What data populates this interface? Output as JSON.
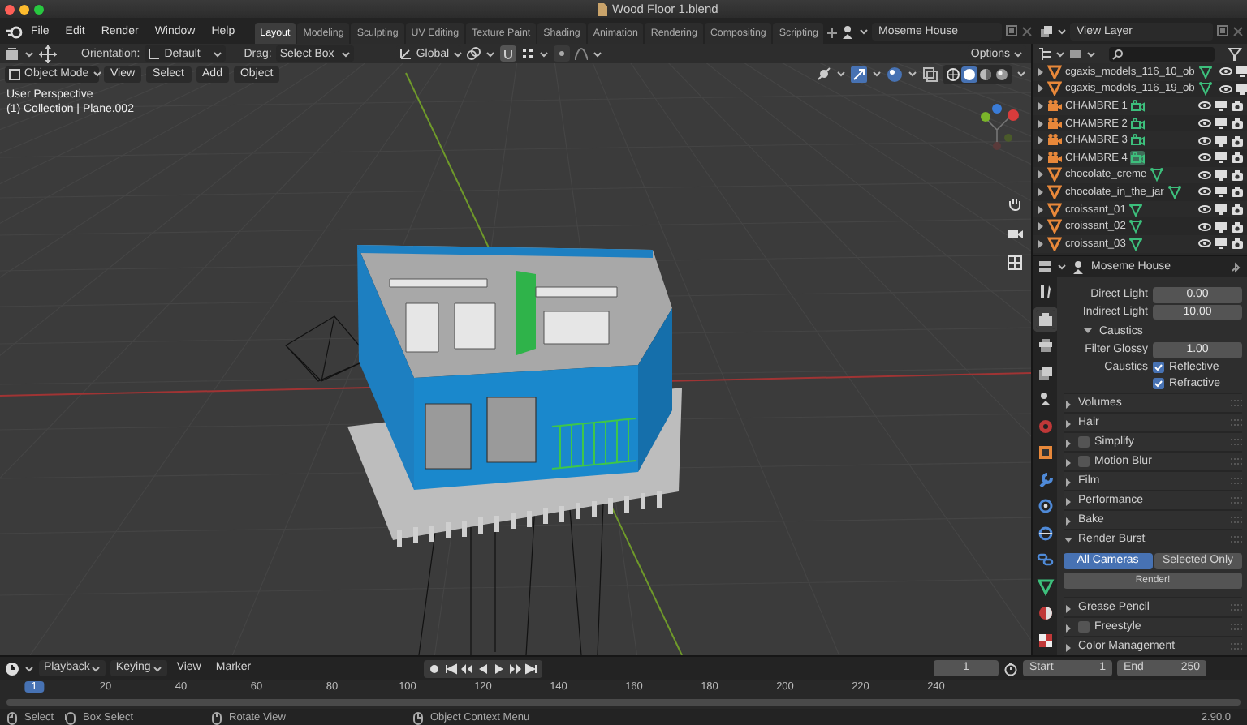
{
  "window": {
    "title": "Wood Floor 1.blend"
  },
  "menu": [
    "File",
    "Edit",
    "Render",
    "Window",
    "Help"
  ],
  "workspaces": [
    {
      "label": "Layout",
      "selected": true
    },
    {
      "label": "Modeling",
      "selected": false
    },
    {
      "label": "Sculpting",
      "selected": false
    },
    {
      "label": "UV Editing",
      "selected": false
    },
    {
      "label": "Texture Paint",
      "selected": false
    },
    {
      "label": "Shading",
      "selected": false
    },
    {
      "label": "Animation",
      "selected": false
    },
    {
      "label": "Rendering",
      "selected": false
    },
    {
      "label": "Compositing",
      "selected": false
    },
    {
      "label": "Scripting",
      "selected": false
    }
  ],
  "scene": {
    "name": "Moseme House"
  },
  "view_layer": {
    "name": "View Layer"
  },
  "tool_settings": {
    "orientation_label": "Orientation:",
    "orientation": "Default",
    "drag_label": "Drag:",
    "drag": "Select Box",
    "transform_orientation": "Global",
    "options": "Options"
  },
  "viewport_header": {
    "mode": "Object Mode",
    "menus": [
      "View",
      "Select",
      "Add",
      "Object"
    ],
    "shading": [
      {
        "kind": "wireframe",
        "selected": false
      },
      {
        "kind": "solid",
        "selected": true
      },
      {
        "kind": "material",
        "selected": false
      },
      {
        "kind": "rendered",
        "selected": false
      }
    ]
  },
  "viewport": {
    "perspective": "User Perspective",
    "context": "(1) Collection | Plane.002"
  },
  "outliner": {
    "items": [
      {
        "name": "cgaxis_models_116_10_ob",
        "kind": "mesh",
        "active": false
      },
      {
        "name": "cgaxis_models_116_19_ob",
        "kind": "mesh",
        "active": false
      },
      {
        "name": "CHAMBRE 1",
        "kind": "camera",
        "active": false
      },
      {
        "name": "CHAMBRE 2",
        "kind": "camera",
        "active": false
      },
      {
        "name": "CHAMBRE 3",
        "kind": "camera",
        "active": false
      },
      {
        "name": "CHAMBRE 4",
        "kind": "camera",
        "active": true
      },
      {
        "name": "chocolate_creme",
        "kind": "mesh",
        "active": false
      },
      {
        "name": "chocolate_in_the_jar",
        "kind": "mesh",
        "active": false
      },
      {
        "name": "croissant_01",
        "kind": "mesh",
        "active": false
      },
      {
        "name": "croissant_02",
        "kind": "mesh",
        "active": false
      },
      {
        "name": "croissant_03",
        "kind": "mesh",
        "active": false
      }
    ]
  },
  "properties": {
    "object": "Moseme House",
    "tabs": [
      {
        "kind": "tool",
        "selected": false
      },
      {
        "kind": "render",
        "selected": true
      },
      {
        "kind": "output",
        "selected": false
      },
      {
        "kind": "view_layer",
        "selected": false
      },
      {
        "kind": "scene",
        "selected": false
      },
      {
        "kind": "world",
        "selected": false
      },
      {
        "kind": "object",
        "selected": false
      },
      {
        "kind": "modifiers",
        "selected": false
      },
      {
        "kind": "particles",
        "selected": false
      },
      {
        "kind": "physics",
        "selected": false
      },
      {
        "kind": "constraints",
        "selected": false
      },
      {
        "kind": "data",
        "selected": false
      },
      {
        "kind": "material",
        "selected": false
      },
      {
        "kind": "texture",
        "selected": false
      }
    ],
    "rows": [
      {
        "kind": "field",
        "label": "Direct Light",
        "value": "0.00"
      },
      {
        "kind": "field",
        "label": "Indirect Light",
        "value": "10.00"
      },
      {
        "kind": "subpanel",
        "label": "Caustics",
        "expanded": true
      },
      {
        "kind": "field",
        "label": "Filter Glossy",
        "value": "1.00"
      },
      {
        "kind": "check",
        "label": "Caustics",
        "text": "Reflective",
        "checked": true
      },
      {
        "kind": "check",
        "text": "Refractive",
        "checked": true
      },
      {
        "kind": "panel",
        "label": "Volumes",
        "expanded": false
      },
      {
        "kind": "panel",
        "label": "Hair",
        "expanded": false
      },
      {
        "kind": "panel_check",
        "label": "Simplify",
        "expanded": false,
        "checked": false
      },
      {
        "kind": "panel_check",
        "label": "Motion Blur",
        "expanded": false,
        "checked": false
      },
      {
        "kind": "panel",
        "label": "Film",
        "expanded": false
      },
      {
        "kind": "panel",
        "label": "Performance",
        "expanded": false
      },
      {
        "kind": "panel",
        "label": "Bake",
        "expanded": false
      },
      {
        "kind": "panel",
        "label": "Render Burst",
        "expanded": true
      },
      {
        "kind": "segmented",
        "options": [
          {
            "label": "All Cameras",
            "selected": true
          },
          {
            "label": "Selected Only",
            "selected": false
          }
        ]
      },
      {
        "kind": "button",
        "label": "Render!"
      },
      {
        "kind": "panel",
        "label": "Grease Pencil",
        "expanded": false
      },
      {
        "kind": "panel_check",
        "label": "Freestyle",
        "expanded": false,
        "checked": false
      },
      {
        "kind": "panel",
        "label": "Color Management",
        "expanded": false
      }
    ]
  },
  "timeline": {
    "menus": [
      {
        "label": "Playback",
        "dropdown": true
      },
      {
        "label": "Keying",
        "dropdown": true
      },
      {
        "label": "View",
        "dropdown": false
      },
      {
        "label": "Marker",
        "dropdown": false
      }
    ],
    "current_frame": "1",
    "start_label": "Start",
    "start": "1",
    "end_label": "End",
    "end": "250",
    "ruler": [
      "1",
      "20",
      "40",
      "60",
      "80",
      "100",
      "120",
      "140",
      "160",
      "180",
      "200",
      "220",
      "240"
    ]
  },
  "status_bar": {
    "hints": [
      {
        "kind": "left_click",
        "label": "Select"
      },
      {
        "kind": "drag",
        "label": "Box Select"
      },
      {
        "kind": "middle_click",
        "label": "Rotate View"
      },
      {
        "kind": "right_click",
        "label": "Object Context Menu"
      }
    ],
    "version": "2.90.0"
  }
}
